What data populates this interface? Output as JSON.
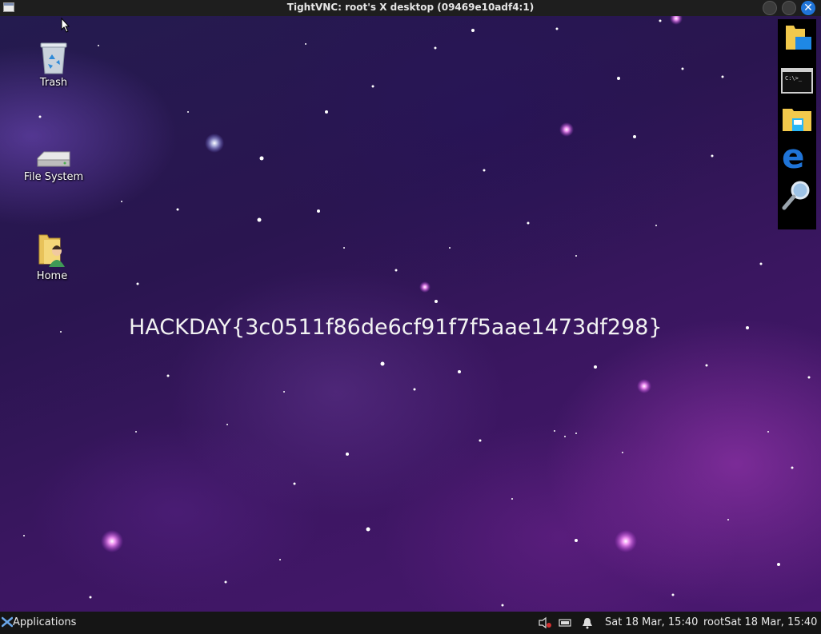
{
  "window": {
    "title": "TightVNC: root's X desktop (09469e10adf4:1)"
  },
  "desktop": {
    "icons": [
      {
        "label": "Trash"
      },
      {
        "label": "File System"
      },
      {
        "label": "Home"
      }
    ],
    "wallpaper_text": "HACKDAY{3c0511f86de6cf91f7f5aae1473df298}"
  },
  "dock": {
    "items": [
      "file-manager-icon",
      "terminal-icon",
      "files-icon",
      "browser-icon",
      "search-icon"
    ]
  },
  "taskbar": {
    "applications_label": "Applications",
    "clock": "Sat 18 Mar, 15:40",
    "user_clock": "rootSat 18 Mar, 15:40"
  },
  "colors": {
    "titlebar": "#1e1e1e",
    "taskbar": "#151515",
    "close_button": "#1f74d8"
  }
}
